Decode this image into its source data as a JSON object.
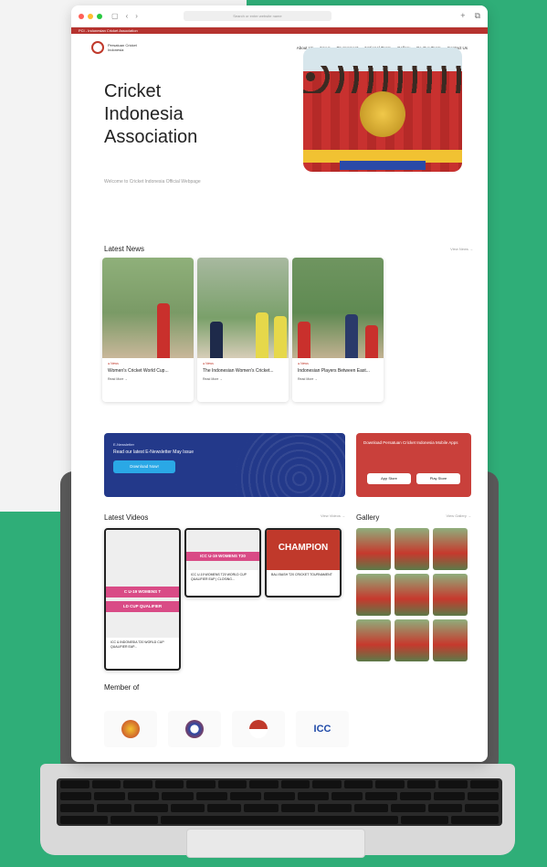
{
  "browser": {
    "url_text": "Search or enter website name"
  },
  "site": {
    "topbar": "PCI - Indonesian Cricket Association",
    "logo_line1": "Persatuan Cricket",
    "logo_line2": "Indonesia",
    "nav": [
      "About Us",
      "News",
      "Tournament",
      "National Team",
      "Gallery",
      "Be Our Team",
      "Contact Us"
    ],
    "hero_title_1": "Cricket",
    "hero_title_2": "Indonesia",
    "hero_title_3": "Association",
    "hero_subtitle": "Welcome to Cricket Indonesia Official Webpage"
  },
  "news": {
    "title": "Latest News",
    "view_all": "View News →",
    "cards": [
      {
        "tag": "● News",
        "title": "Women's Cricket World Cup...",
        "read": "Read More →"
      },
      {
        "tag": "● News",
        "title": "The Indonesian Women's Cricket...",
        "read": "Read More →"
      },
      {
        "tag": "● News",
        "title": "Indonesian Players Between East...",
        "read": "Read More →"
      }
    ]
  },
  "newsletter": {
    "tag": "E-Newsletter",
    "text": "Read our latest E-Newsletter May Issue",
    "button": "Download Now!"
  },
  "download": {
    "title": "Download Persatuan Cricket Indonesia Mobile Apps",
    "app_store": "App Store",
    "play_store": "Play Store"
  },
  "videos": {
    "title": "Latest Videos",
    "view_all": "View Videos →",
    "items": [
      {
        "banner": "C U-19 WOMENS T",
        "banner2": "LD CUP QUALIFIER",
        "title": "ICC & INDONESIA T20 WORLD CUP QUALIFIER EAP..."
      },
      {
        "banner": "ICC U-19 WOMENS T20",
        "title": "ICC U-19 WOMENS T20 WORLD CUP QUALIFIER EAP | CLOSING..."
      },
      {
        "banner": "CHAMPION",
        "title": "BALI BASH T20 CRICKET TOURNAMENT"
      }
    ]
  },
  "gallery": {
    "title": "Gallery",
    "view_all": "View Gallery →"
  },
  "members": {
    "title": "Member of",
    "icc": "ICC"
  }
}
